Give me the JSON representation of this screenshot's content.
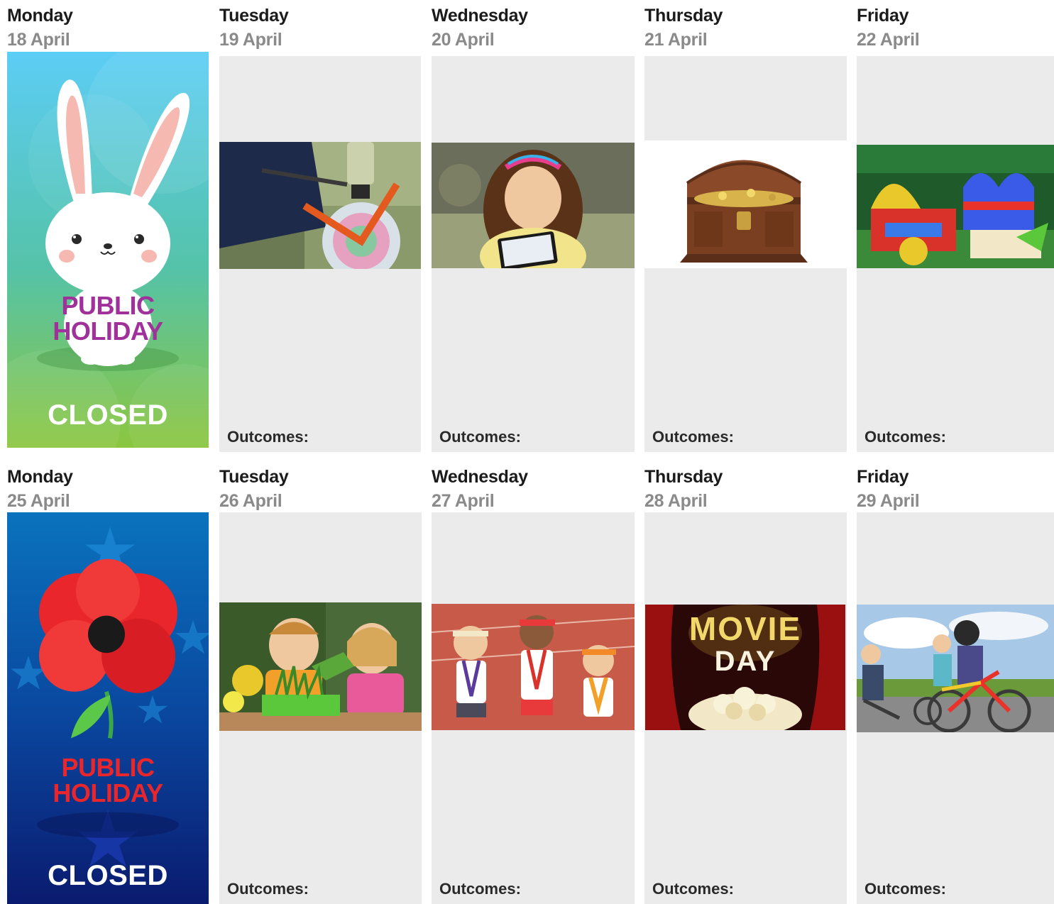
{
  "weeks": [
    {
      "days": [
        {
          "name": "Monday",
          "date": "18 April",
          "holiday": true,
          "holiday_line1": "PUBLIC",
          "holiday_line2": "HOLIDAY",
          "closed": "CLOSED",
          "theme": "easter-bunny"
        },
        {
          "name": "Tuesday",
          "date": "19 April",
          "image": "bike-blender-photo",
          "outcomes": "Outcomes:"
        },
        {
          "name": "Wednesday",
          "date": "20 April",
          "image": "girl-tablet-photo",
          "outcomes": "Outcomes:"
        },
        {
          "name": "Thursday",
          "date": "21 April",
          "image": "treasure-chest-photo",
          "outcomes": "Outcomes:"
        },
        {
          "name": "Friday",
          "date": "22 April",
          "image": "bouncy-castle-photo",
          "outcomes": "Outcomes:"
        }
      ]
    },
    {
      "days": [
        {
          "name": "Monday",
          "date": "25 April",
          "holiday": true,
          "holiday_line1": "PUBLIC",
          "holiday_line2": "HOLIDAY",
          "closed": "CLOSED",
          "theme": "anzac-poppy"
        },
        {
          "name": "Tuesday",
          "date": "26 April",
          "image": "kids-gardening-photo",
          "outcomes": "Outcomes:"
        },
        {
          "name": "Wednesday",
          "date": "27 April",
          "image": "kids-athletes-photo",
          "outcomes": "Outcomes:"
        },
        {
          "name": "Thursday",
          "date": "28 April",
          "image": "movie-day-photo",
          "image_text_line1": "MOVIE",
          "image_text_line2": "DAY",
          "outcomes": "Outcomes:"
        },
        {
          "name": "Friday",
          "date": "29 April",
          "image": "kids-bikes-photo",
          "outcomes": "Outcomes:"
        }
      ]
    }
  ],
  "colors": {
    "card_bg": "#ebebeb",
    "day_name": "#1b1b1b",
    "day_date": "#8a8a8a",
    "easter_top": "#5ccdf5",
    "easter_bottom": "#8cc63f",
    "easter_text": "#a0309a",
    "anzac_top": "#0a73bd",
    "anzac_bottom": "#0a1a6e",
    "anzac_text": "#e8262b"
  }
}
